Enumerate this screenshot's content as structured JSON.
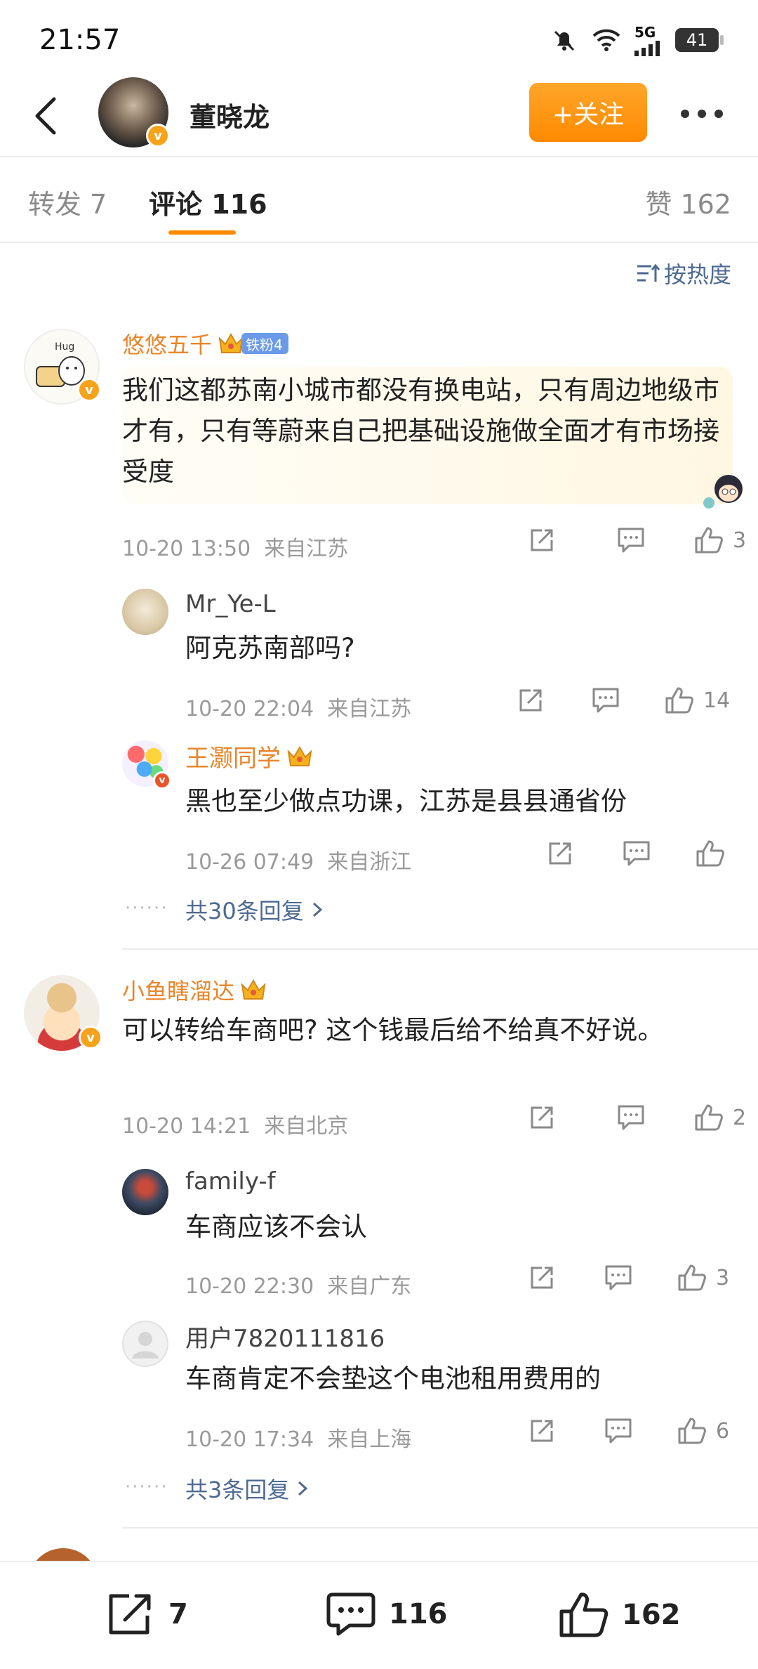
{
  "status_bar": {
    "time": "21:57",
    "network": "5G",
    "battery": "41"
  },
  "header": {
    "user_name": "董晓龙",
    "follow_label": "+关注"
  },
  "tabs": {
    "repost_label": "转发 7",
    "comment_label": "评论 116",
    "likes_label": "赞 162"
  },
  "sort_label": "按热度",
  "comments": [
    {
      "author": "悠悠五千",
      "fan_badge": "铁粉4",
      "text": "我们这都苏南小城市都没有换电站，只有周边地级市才有，只有等蔚来自己把基础设施做全面才有市场接受度",
      "time": "10-20 13:50",
      "location": "来自江苏",
      "likes": "3",
      "replies": [
        {
          "author": "Mr_Ye-L",
          "text": "阿克苏南部吗?",
          "time": "10-20 22:04",
          "location": "来自江苏",
          "likes": "14"
        },
        {
          "author": "王灏同学",
          "text": "黑也至少做点功课，江苏是县县通省份",
          "time": "10-26 07:49",
          "location": "来自浙江",
          "likes": ""
        }
      ],
      "more_replies": "共30条回复"
    },
    {
      "author": "小鱼瞎溜达",
      "text": "可以转给车商吧? 这个钱最后给不给真不好说。",
      "time": "10-20 14:21",
      "location": "来自北京",
      "likes": "2",
      "replies": [
        {
          "author": "family-f",
          "text": "车商应该不会认",
          "time": "10-20 22:30",
          "location": "来自广东",
          "likes": "3"
        },
        {
          "author": "用户7820111816",
          "text": "车商肯定不会垫这个电池租用费用的",
          "time": "10-20 17:34",
          "location": "来自上海",
          "likes": "6"
        }
      ],
      "more_replies": "共3条回复"
    }
  ],
  "bottom_bar": {
    "repost_count": "7",
    "comment_count": "116",
    "like_count": "162"
  },
  "colors": {
    "accent": "#ff8a00",
    "author": "#e8852a",
    "link": "#4e6a91",
    "meta": "#9a9a9a"
  },
  "icons": [
    "back-icon",
    "more-icon",
    "sort-icon",
    "share-icon",
    "comment-icon",
    "like-icon",
    "chevron-right-icon",
    "crown-icon",
    "verified-icon"
  ]
}
